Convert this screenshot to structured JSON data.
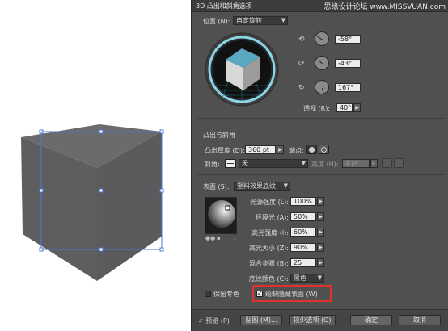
{
  "dialog": {
    "title": "3D 凸出和斜角选项",
    "watermark": "思缘设计论坛 www.MISSVUAN.com"
  },
  "position": {
    "label": "位置 (N):",
    "value": "自定旋转",
    "rotation": [
      {
        "icon": "x-axis-icon",
        "value": "-58°"
      },
      {
        "icon": "y-axis-icon",
        "value": "-43°"
      },
      {
        "icon": "z-axis-icon",
        "value": "167°"
      }
    ],
    "perspective_label": "透视 (R):",
    "perspective_value": "40°"
  },
  "extrude": {
    "section_label": "凸出与斜角",
    "depth_label": "凸出厚度 (D):",
    "depth_value": "360 pt",
    "cap_label": "端点:",
    "bevel_label": "斜角:",
    "bevel_value": "无",
    "height_label": "高度 (H):",
    "height_value": "4 pt"
  },
  "surface": {
    "label": "表面 (S):",
    "value": "塑料效果底纹",
    "rows": [
      {
        "label": "光源强度 (L):",
        "value": "100%"
      },
      {
        "label": "环境光 (A):",
        "value": "50%"
      },
      {
        "label": "高光强度 (I):",
        "value": "60%"
      },
      {
        "label": "高光大小 (Z):",
        "value": "90%"
      },
      {
        "label": "混合步骤 (B):",
        "value": "25"
      },
      {
        "label": "底纹颜色 (C):",
        "value": "黑色"
      }
    ]
  },
  "options": {
    "preserve_spot": "保留专色",
    "draw_hidden": "绘制隐藏表面 (W)"
  },
  "footer": {
    "preview": "预览 (P)",
    "map": "贴图 (M)...",
    "fewer": "较少选项 (O)",
    "ok": "确定",
    "cancel": "取消"
  },
  "colors": {
    "dialog_bg": "#505050",
    "cube_face": "#5e5e60",
    "selection": "#4a78d8",
    "highlight": "#e03030"
  }
}
